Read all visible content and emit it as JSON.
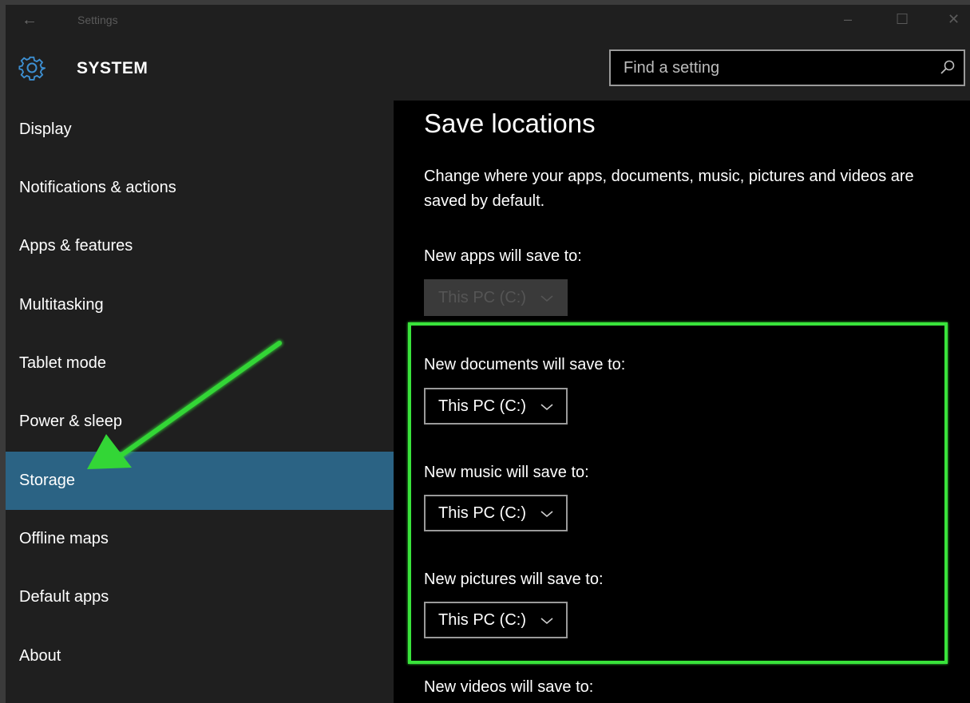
{
  "titlebar": {
    "back_icon": "back-arrow-icon",
    "title": "Settings",
    "minimize": "–",
    "maximize": "☐",
    "close": "✕"
  },
  "header": {
    "icon": "gear-icon",
    "title": "SYSTEM",
    "search_placeholder": "Find a setting",
    "search_icon": "search-icon"
  },
  "sidebar": {
    "items": [
      {
        "label": "Display",
        "selected": false
      },
      {
        "label": "Notifications & actions",
        "selected": false
      },
      {
        "label": "Apps & features",
        "selected": false
      },
      {
        "label": "Multitasking",
        "selected": false
      },
      {
        "label": "Tablet mode",
        "selected": false
      },
      {
        "label": "Power & sleep",
        "selected": false
      },
      {
        "label": "Storage",
        "selected": true
      },
      {
        "label": "Offline maps",
        "selected": false
      },
      {
        "label": "Default apps",
        "selected": false
      },
      {
        "label": "About",
        "selected": false
      }
    ]
  },
  "content": {
    "heading": "Save locations",
    "description": "Change where your apps, documents, music, pictures and videos are saved by default.",
    "settings": [
      {
        "label": "New apps will save to:",
        "value": "This PC (C:)",
        "disabled": true
      },
      {
        "label": "New documents will save to:",
        "value": "This PC (C:)",
        "disabled": false
      },
      {
        "label": "New music will save to:",
        "value": "This PC (C:)",
        "disabled": false
      },
      {
        "label": "New pictures will save to:",
        "value": "This PC (C:)",
        "disabled": false
      },
      {
        "label": "New videos will save to:"
      }
    ]
  },
  "colors": {
    "selected_nav": "#2b6384",
    "annotation_green": "#39e33b",
    "sidebar_bg": "#1f1f1f",
    "content_bg": "#000000"
  }
}
